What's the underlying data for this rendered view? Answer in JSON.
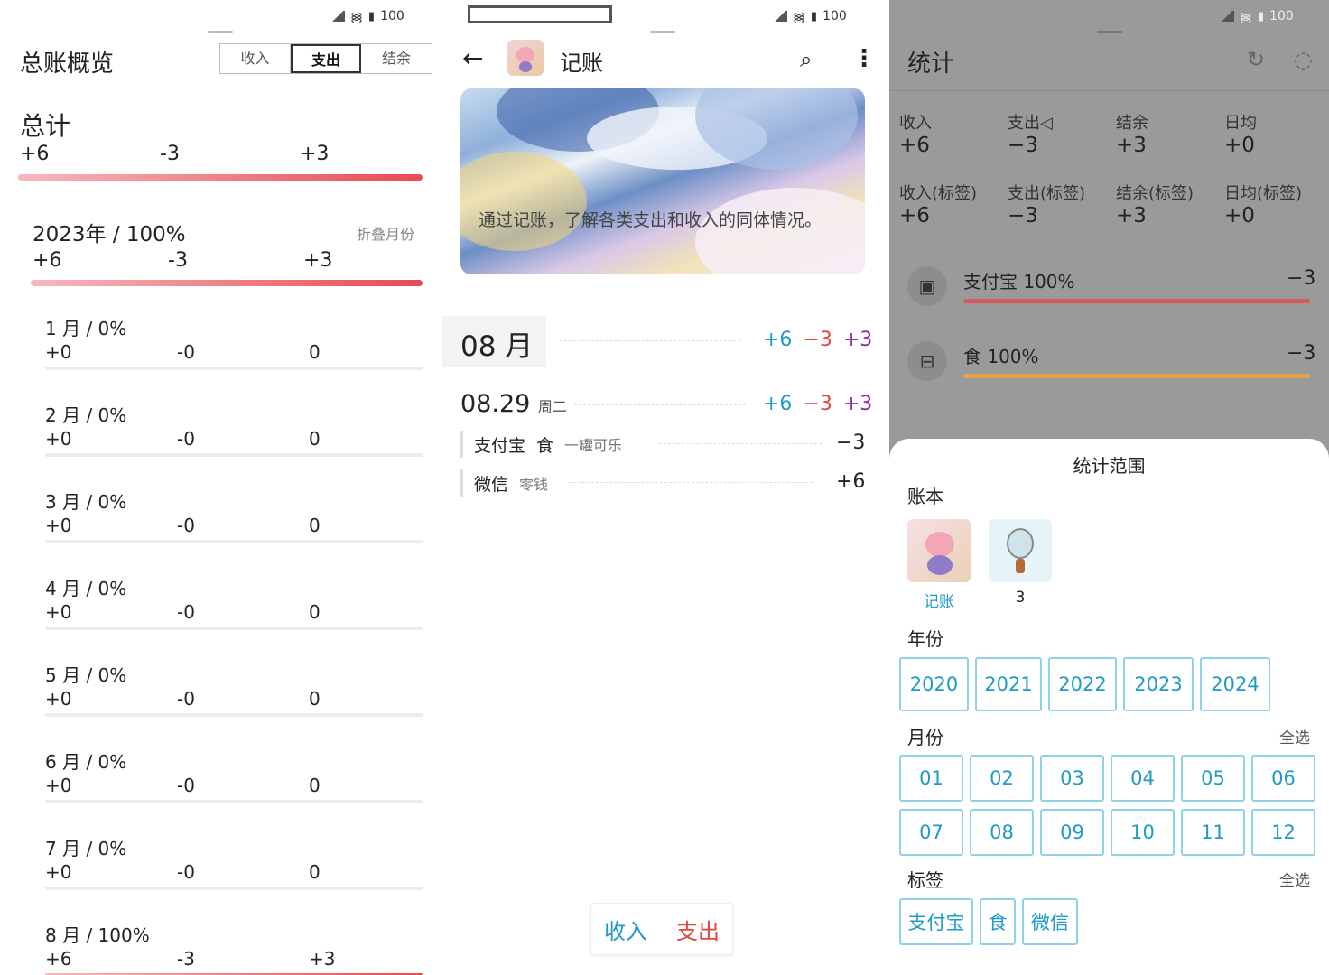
{
  "status": {
    "battery": "100"
  },
  "overview": {
    "title": "总账概览",
    "tabs": [
      "收入",
      "支出",
      "结余"
    ],
    "active_tab": "支出",
    "total_label": "总计",
    "total": {
      "income": "+6",
      "expense": "-3",
      "balance": "+3"
    },
    "year_label": "2023年 / 100%",
    "fold_label": "折叠月份",
    "year": {
      "income": "+6",
      "expense": "-3",
      "balance": "+3"
    },
    "months": [
      {
        "label": "1 月 / 0%",
        "income": "+0",
        "expense": "-0",
        "balance": "0"
      },
      {
        "label": "2 月 / 0%",
        "income": "+0",
        "expense": "-0",
        "balance": "0"
      },
      {
        "label": "3 月 / 0%",
        "income": "+0",
        "expense": "-0",
        "balance": "0"
      },
      {
        "label": "4 月 / 0%",
        "income": "+0",
        "expense": "-0",
        "balance": "0"
      },
      {
        "label": "5 月 / 0%",
        "income": "+0",
        "expense": "-0",
        "balance": "0"
      },
      {
        "label": "6 月 / 0%",
        "income": "+0",
        "expense": "-0",
        "balance": "0"
      },
      {
        "label": "7 月 / 0%",
        "income": "+0",
        "expense": "-0",
        "balance": "0"
      },
      {
        "label": "8 月 / 100%",
        "income": "+6",
        "expense": "-3",
        "balance": "+3",
        "fill": 1.0
      }
    ]
  },
  "ledger": {
    "title": "记账",
    "banner_text": "通过记账，了解各类支出和收入的同体情况。",
    "month": "08 月",
    "month_totals": {
      "income": "+6",
      "expense": "−3",
      "balance": "+3"
    },
    "day": "08.29",
    "weekday": "周二",
    "day_totals": {
      "income": "+6",
      "expense": "−3",
      "balance": "+3"
    },
    "entries": [
      {
        "account": "支付宝",
        "category": "食",
        "note": "一罐可乐",
        "amount": "−3"
      },
      {
        "account": "微信",
        "category": "",
        "note": "零钱",
        "amount": "+6"
      }
    ],
    "income_btn": "收入",
    "expense_btn": "支出"
  },
  "stats": {
    "title": "统计",
    "cells": [
      {
        "label": "收入",
        "value": "+6"
      },
      {
        "label": "支出◁",
        "value": "−3"
      },
      {
        "label": "结余",
        "value": "+3"
      },
      {
        "label": "日均",
        "value": "+0"
      },
      {
        "label": "收入(标签)",
        "value": "+6"
      },
      {
        "label": "支出(标签)",
        "value": "−3"
      },
      {
        "label": "结余(标签)",
        "value": "+3"
      },
      {
        "label": "日均(标签)",
        "value": "+0"
      }
    ],
    "categories": [
      {
        "name": "支付宝 100%",
        "value": "−3",
        "color": "#d65a5f",
        "fill": 1.0
      },
      {
        "name": "食 100%",
        "value": "−3",
        "color": "#e7a34a",
        "fill": 1.0
      }
    ],
    "sheet": {
      "title": "统计范围",
      "book_label": "账本",
      "books": [
        "记账",
        "3"
      ],
      "year_label": "年份",
      "years": [
        "2020",
        "2021",
        "2022",
        "2023",
        "2024"
      ],
      "month_label": "月份",
      "select_all": "全选",
      "months": [
        "01",
        "02",
        "03",
        "04",
        "05",
        "06",
        "07",
        "08",
        "09",
        "10",
        "11",
        "12"
      ],
      "tag_label": "标签",
      "tags": [
        "支付宝",
        "食",
        "微信"
      ]
    }
  },
  "colors": {
    "income": "#1e9bc6",
    "expense": "#e0453f",
    "balance": "#8e2aa8",
    "accent": "#1e9bc6"
  }
}
